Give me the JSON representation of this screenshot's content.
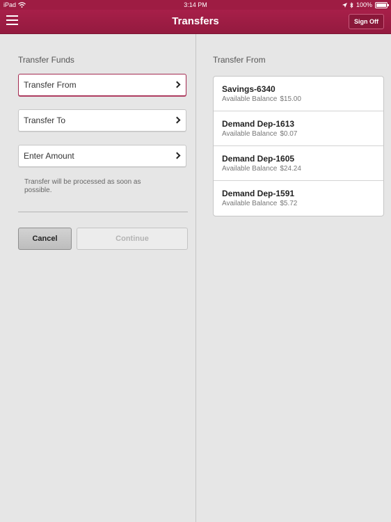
{
  "status_bar": {
    "device": "iPad",
    "time": "3:14 PM",
    "battery": "100%"
  },
  "nav": {
    "title": "Transfers",
    "sign_off_label": "Sign Off"
  },
  "left": {
    "heading": "Transfer Funds",
    "fields": [
      {
        "label": "Transfer From"
      },
      {
        "label": "Transfer To"
      },
      {
        "label": "Enter Amount"
      }
    ],
    "note": "Transfer will be processed as soon as possible.",
    "cancel_label": "Cancel",
    "continue_label": "Continue"
  },
  "right": {
    "heading": "Transfer From",
    "accounts": [
      {
        "name": "Savings-6340",
        "balance_label": "Available Balance",
        "balance": "$15.00"
      },
      {
        "name": "Demand Dep-1613",
        "balance_label": "Available Balance",
        "balance": "$0.07"
      },
      {
        "name": "Demand Dep-1605",
        "balance_label": "Available Balance",
        "balance": "$24.24"
      },
      {
        "name": "Demand Dep-1591",
        "balance_label": "Available Balance",
        "balance": "$5.72"
      }
    ]
  },
  "colors": {
    "brand": "#9e1c43",
    "background": "#e6e6e6"
  },
  "icons": [
    "wifi-icon",
    "location-icon",
    "bluetooth-icon",
    "battery-icon",
    "menu-icon",
    "chevron-right-icon"
  ]
}
